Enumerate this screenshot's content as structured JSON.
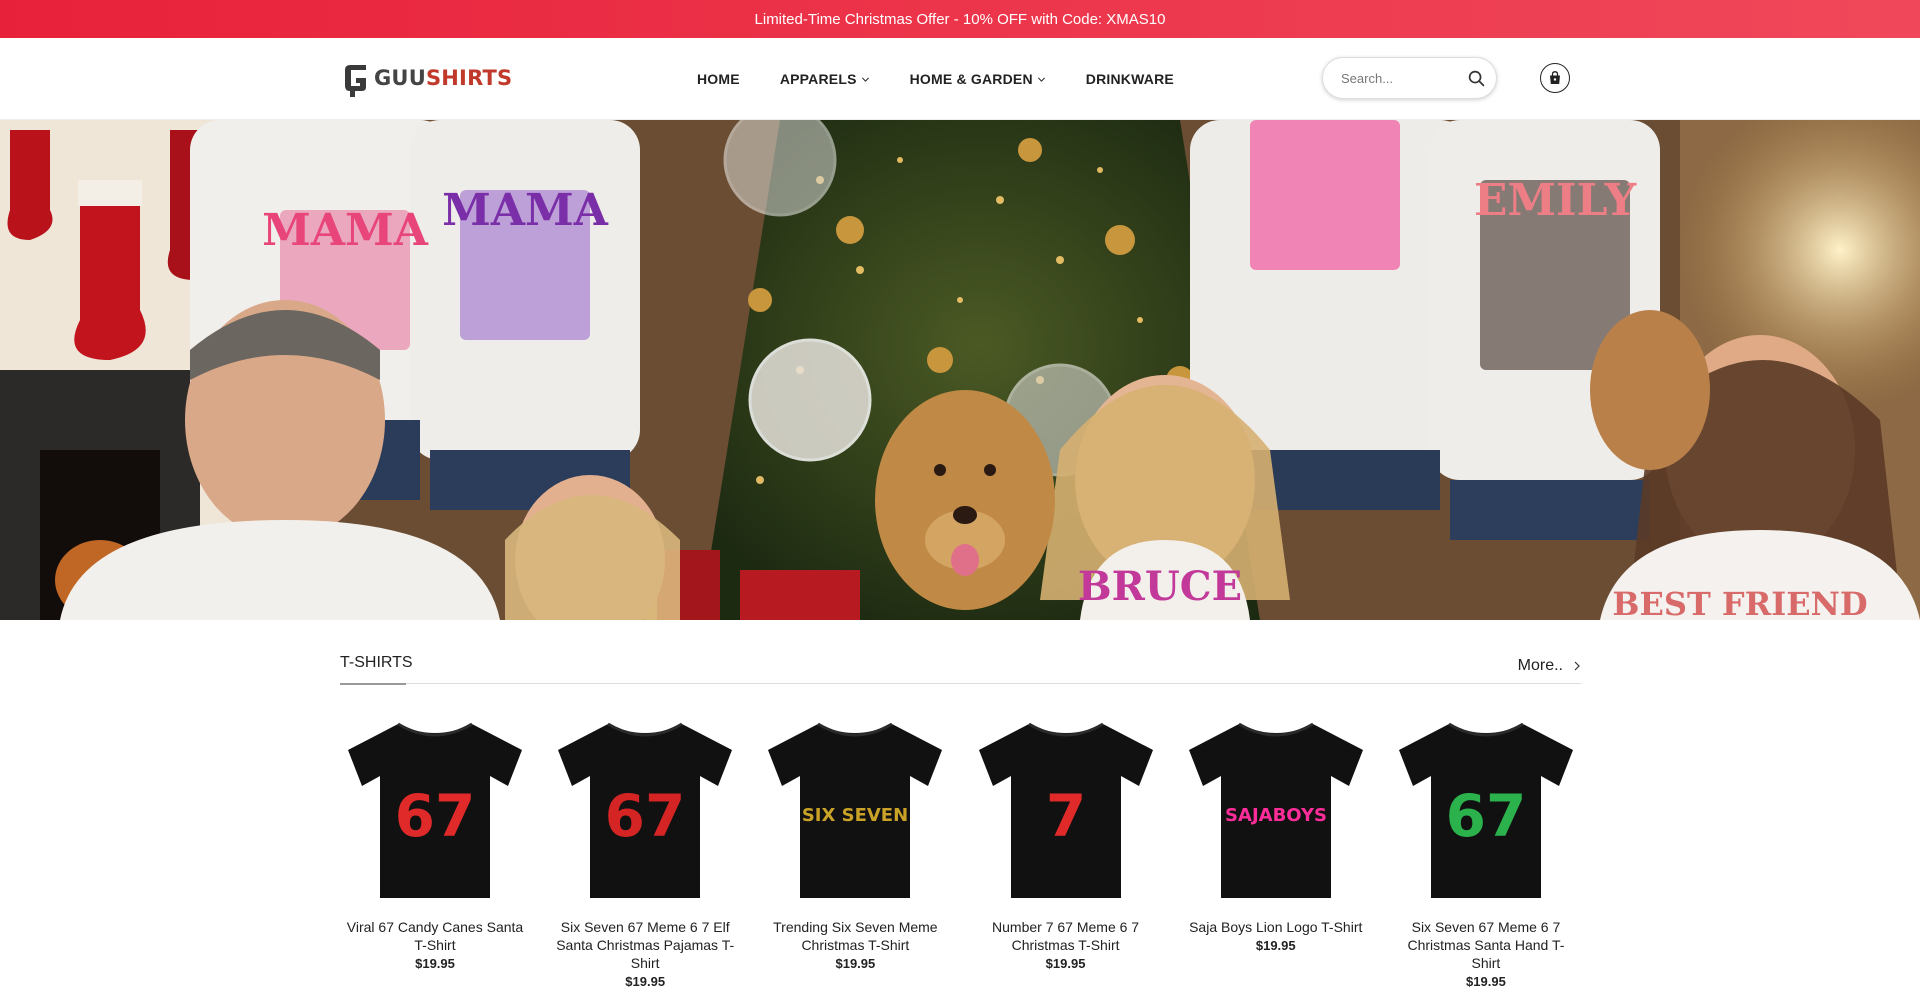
{
  "promo": {
    "text": "Limited-Time Christmas Offer - 10% OFF with Code: XMAS10"
  },
  "brand": {
    "part1": "GUU",
    "part2": "SHIRTS",
    "accent_color": "#c0392b"
  },
  "nav": {
    "items": [
      {
        "label": "HOME",
        "has_dropdown": false
      },
      {
        "label": "APPARELS",
        "has_dropdown": true
      },
      {
        "label": "HOME & GARDEN",
        "has_dropdown": true
      },
      {
        "label": "DRINKWARE",
        "has_dropdown": false
      }
    ]
  },
  "search": {
    "placeholder": "Search...",
    "value": ""
  },
  "hero": {
    "shirt_texts": [
      "MAMA",
      "MAMA",
      "EMILY",
      "BRUCE",
      "BEST FRIEND"
    ]
  },
  "section": {
    "title": "T-SHIRTS",
    "more_label": "More.."
  },
  "products": [
    {
      "name": "Viral 67 Candy Canes Santa T-Shirt",
      "price": "$19.95",
      "print": "67",
      "color": "#e02a2a"
    },
    {
      "name": "Six Seven 67 Meme 6 7 Elf Santa Christmas Pajamas T-Shirt",
      "price": "$19.95",
      "print": "67",
      "color": "#d42424"
    },
    {
      "name": "Trending Six Seven Meme Christmas T-Shirt",
      "price": "$19.95",
      "print": "SIX SEVEN",
      "color": "#c9a227"
    },
    {
      "name": "Number 7 67 Meme 6 7 Christmas T-Shirt",
      "price": "$19.95",
      "print": "7",
      "color": "#e02a2a"
    },
    {
      "name": "Saja Boys Lion Logo T-Shirt",
      "price": "$19.95",
      "print": "SAJABOYS",
      "color": "#ff2d9a"
    },
    {
      "name": "Six Seven 67 Meme 6 7 Christmas Santa Hand T-Shirt",
      "price": "$19.95",
      "print": "67",
      "color": "#2bb24c"
    }
  ],
  "colors": {
    "promo_bg": "#e8213a",
    "text": "#222222"
  }
}
